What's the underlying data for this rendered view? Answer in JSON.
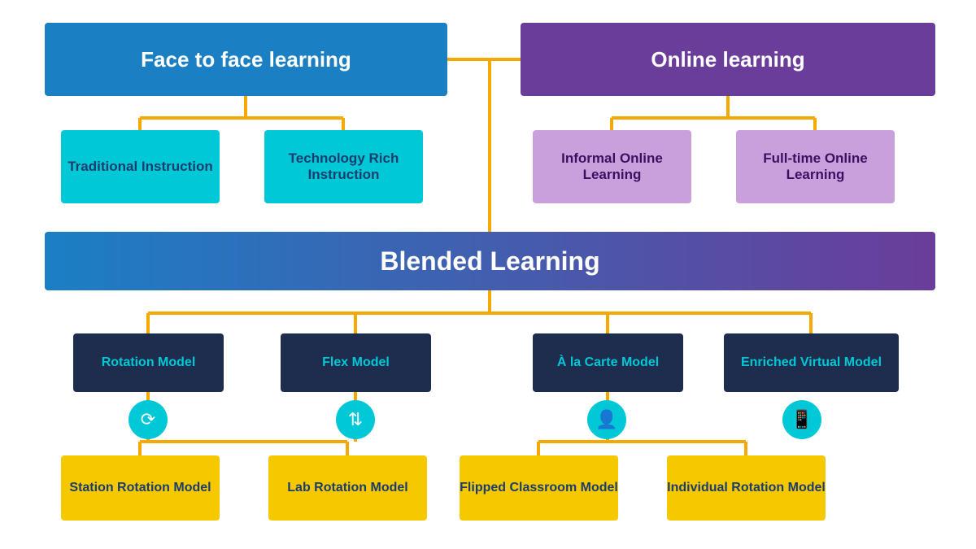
{
  "nodes": {
    "face_to_face": "Face to face learning",
    "online_learning": "Online learning",
    "traditional": "Traditional Instruction",
    "tech_rich": "Technology Rich Instruction",
    "informal_online": "Informal Online Learning",
    "fulltime_online": "Full-time Online Learning",
    "blended": "Blended Learning",
    "rotation_model": "Rotation Model",
    "flex_model": "Flex Model",
    "ala_carte": "À la Carte Model",
    "enriched_virtual": "Enriched Virtual Model",
    "station_rotation": "Station Rotation Model",
    "lab_rotation": "Lab Rotation Model",
    "flipped_classroom": "Flipped Classroom Model",
    "individual_rotation": "Individual Rotation Model"
  },
  "colors": {
    "connector": "#f5a800"
  }
}
